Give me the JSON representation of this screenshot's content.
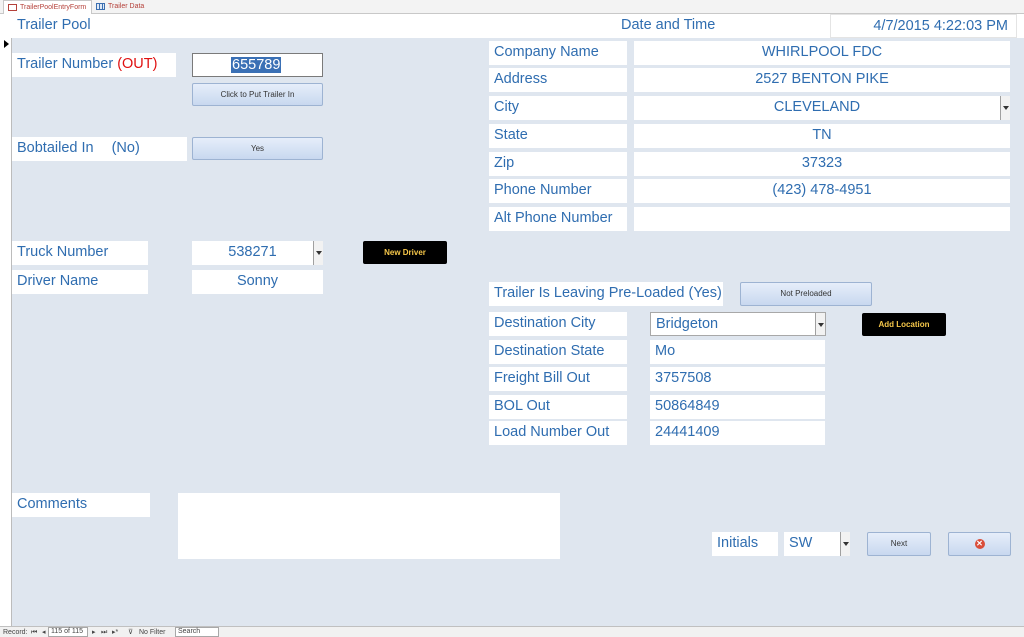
{
  "tabs": [
    {
      "label": "TrailerPoolEntryForm",
      "active": true
    },
    {
      "label": "Trailer Data",
      "active": false
    }
  ],
  "header": {
    "title": "Trailer Pool",
    "date_label": "Date and Time",
    "date_value": "4/7/2015 4:22:03 PM"
  },
  "trailer": {
    "label": "Trailer Number ",
    "label_status": "(OUT)",
    "value": "655789",
    "put_in_button": "Click to Put Trailer In"
  },
  "bobtail": {
    "label": "Bobtailed In",
    "label_status": "(No)",
    "button": "Yes"
  },
  "truck": {
    "label": "Truck Number",
    "value": "538271",
    "new_driver_button": "New Driver"
  },
  "driver": {
    "label": "Driver Name",
    "value": "Sonny"
  },
  "company": {
    "name_label": "Company Name",
    "name_value": "WHIRLPOOL FDC",
    "address_label": "Address",
    "address_value": "2527 BENTON PIKE",
    "city_label": "City",
    "city_value": "CLEVELAND",
    "state_label": "State",
    "state_value": "TN",
    "zip_label": "Zip",
    "zip_value": "37323",
    "phone_label": "Phone Number",
    "phone_value": "(423) 478-4951",
    "alt_phone_label": "Alt Phone Number",
    "alt_phone_value": ""
  },
  "preload": {
    "label": "Trailer Is Leaving Pre-Loaded (Yes)",
    "button": "Not Preloaded"
  },
  "destination": {
    "city_label": "Destination City",
    "city_value": "Bridgeton",
    "add_location_button": "Add Location",
    "state_label": "Destination State",
    "state_value": "Mo",
    "freight_label": "Freight Bill Out",
    "freight_value": "3757508",
    "bol_label": "BOL Out",
    "bol_value": "50864849",
    "load_label": "Load Number Out",
    "load_value": "24441409"
  },
  "comments": {
    "label": "Comments",
    "value": ""
  },
  "initials": {
    "label": "Initials",
    "value": "SW",
    "next_button": "Next"
  },
  "navbar": {
    "record_label": "Record:",
    "record_value": "115 of 115",
    "filter_label": "No Filter",
    "search_label": "Search"
  },
  "colors": {
    "form_bg": "#dfe6ef",
    "label_text": "#2f6db0",
    "status_red": "#e01010",
    "dark_button": "#000000",
    "dark_button_text": "#f7c84a"
  }
}
